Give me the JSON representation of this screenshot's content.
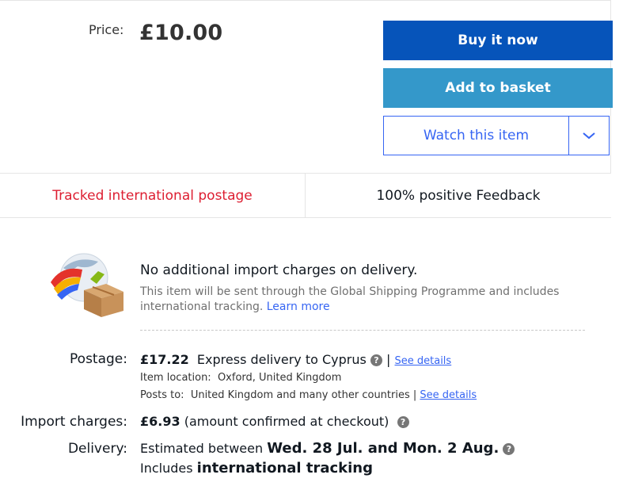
{
  "price": {
    "label": "Price:",
    "value": "£10.00"
  },
  "actions": {
    "buy_now": "Buy it now",
    "add_to_basket": "Add to basket",
    "watch": "Watch this item"
  },
  "banner": {
    "tracked": "Tracked international postage",
    "feedback": "100% positive Feedback"
  },
  "gsp": {
    "title": "No additional import charges on delivery.",
    "desc": "This item will be sent through the Global Shipping Programme and includes international tracking.",
    "learn_more": "Learn more"
  },
  "postage": {
    "label": "Postage:",
    "price": "£17.22",
    "method": "Express delivery to Cyprus",
    "separator": "|",
    "see_details": "See details",
    "location_label": "Item location:",
    "location": "Oxford, United Kingdom",
    "posts_label": "Posts to:",
    "posts_to": "United Kingdom and many other countries",
    "posts_separator": "|",
    "posts_see_details": "See details"
  },
  "import": {
    "label": "Import charges:",
    "amount": "£6.93",
    "note": "(amount confirmed at checkout)"
  },
  "delivery": {
    "label": "Delivery:",
    "prefix": "Estimated between",
    "range": "Wed. 28 Jul. and Mon. 2 Aug.",
    "includes": "Includes",
    "tracking": "international tracking"
  },
  "colors": {
    "buy_now_bg": "#0654ba",
    "basket_bg": "#3498ca",
    "watch_border": "#3665f3",
    "tracked_text": "#dd1e31"
  },
  "icons": {
    "gsp": "globe-box-icon",
    "help": "question-circle-icon",
    "dropdown": "chevron-down-icon"
  }
}
